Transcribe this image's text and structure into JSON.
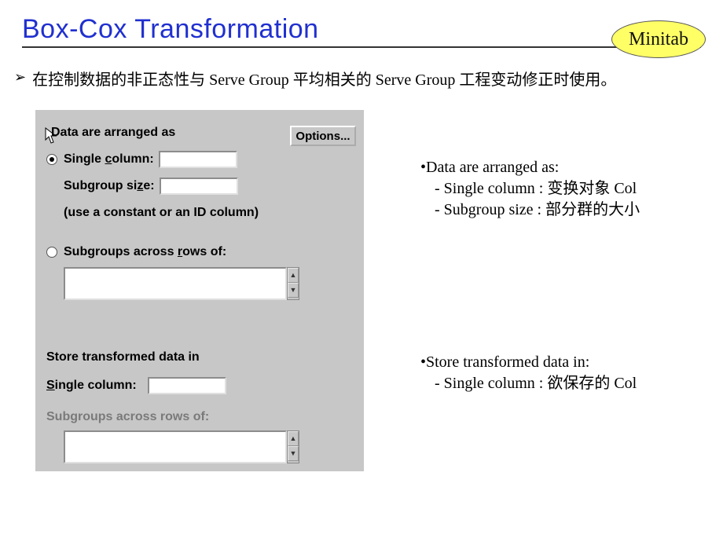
{
  "title": "Box-Cox Transformation",
  "badge": "Minitab",
  "main_bullet": "在控制数据的非正态性与 Serve Group 平均相关的 Serve Group 工程变动修正时使用。",
  "dialog": {
    "data_arranged": "Data are arranged as",
    "options_btn": "Options...",
    "single_column_label_pre": "Single ",
    "single_column_label_ul": "c",
    "single_column_label_post": "olumn:",
    "subgroup_size_label_pre": "Subgroup si",
    "subgroup_size_label_ul": "z",
    "subgroup_size_label_post": "e:",
    "hint": "(use a constant or an ID column)",
    "subgroups_across_label_pre": "Subgroups across ",
    "subgroups_across_label_ul": "r",
    "subgroups_across_label_post": "ows of:",
    "store_label": "Store transformed data in",
    "store_single_label_ul": "S",
    "store_single_label_post": "ingle column:",
    "store_sub_disabled": "Subgroups across rows of:",
    "single_column_value": "",
    "subgroup_size_value": "",
    "subgroups_textarea": "",
    "store_single_value": "",
    "store_sub_textarea": ""
  },
  "annot1": {
    "head": "•Data are arranged as:",
    "l1": " - Single column : 变换对象 Col",
    "l2": " - Subgroup size : 部分群的大小"
  },
  "annot2": {
    "head": "•Store transformed data in:",
    "l1": " - Single column : 欲保存的 Col"
  }
}
